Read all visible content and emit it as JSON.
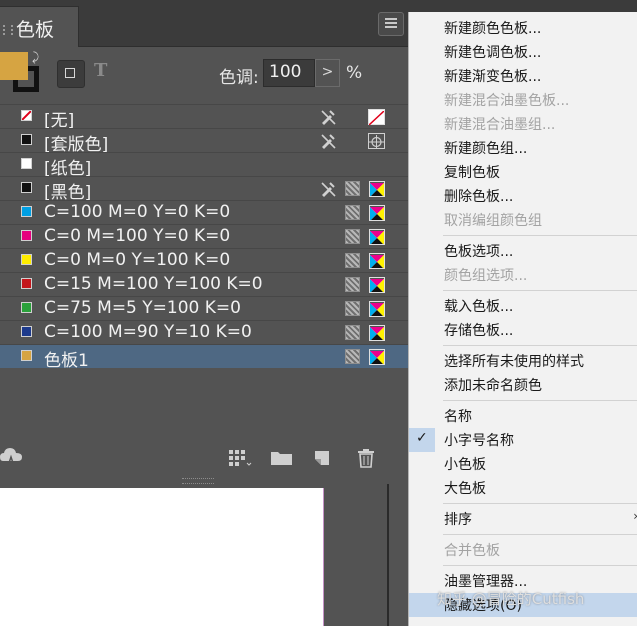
{
  "panel": {
    "tab_label": "色板",
    "tint_label": "色调:",
    "tint_value": "100",
    "tint_stepper": ">",
    "tint_unit": "%",
    "fill_color": "#d6a442",
    "text_mode_glyph": "T"
  },
  "swatches": [
    {
      "name": "[无]",
      "chip": "none",
      "icons": [
        "noedit",
        "none"
      ]
    },
    {
      "name": "[套版色]",
      "chip": "#111111",
      "icons": [
        "noedit",
        "registration"
      ]
    },
    {
      "name": "[纸色]",
      "chip": "#ffffff",
      "icons": []
    },
    {
      "name": "[黑色]",
      "chip": "#111111",
      "icons": [
        "noedit",
        "process",
        "cmyk"
      ]
    },
    {
      "name": "C=100 M=0 Y=0 K=0",
      "chip": "#009fe3",
      "icons": [
        "process",
        "cmyk"
      ]
    },
    {
      "name": "C=0 M=100 Y=0 K=0",
      "chip": "#e6007e",
      "icons": [
        "process",
        "cmyk"
      ]
    },
    {
      "name": "C=0 M=0 Y=100 K=0",
      "chip": "#ffed00",
      "icons": [
        "process",
        "cmyk"
      ]
    },
    {
      "name": "C=15 M=100 Y=100 K=0",
      "chip": "#c4161c",
      "icons": [
        "process",
        "cmyk"
      ]
    },
    {
      "name": "C=75 M=5 Y=100 K=0",
      "chip": "#2aa13b",
      "icons": [
        "process",
        "cmyk"
      ]
    },
    {
      "name": "C=100 M=90 Y=10 K=0",
      "chip": "#1d3a8c",
      "icons": [
        "process",
        "cmyk"
      ]
    },
    {
      "name": "色板1",
      "chip": "#d6a442",
      "icons": [
        "process",
        "cmyk"
      ],
      "selected": true
    }
  ],
  "menu": {
    "items": [
      {
        "label": "新建颜色色板...",
        "disabled": false
      },
      {
        "label": "新建色调色板...",
        "disabled": false
      },
      {
        "label": "新建渐变色板...",
        "disabled": false
      },
      {
        "label": "新建混合油墨色板...",
        "disabled": true
      },
      {
        "label": "新建混合油墨组...",
        "disabled": true
      },
      {
        "label": "新建颜色组...",
        "disabled": false
      },
      {
        "label": "复制色板",
        "disabled": false
      },
      {
        "label": "删除色板...",
        "disabled": false
      },
      {
        "label": "取消编组颜色组",
        "disabled": true
      },
      {
        "label": "色板选项...",
        "disabled": false
      },
      {
        "label": "颜色组选项...",
        "disabled": true
      },
      {
        "label": "载入色板...",
        "disabled": false
      },
      {
        "label": "存储色板...",
        "disabled": false
      },
      {
        "label": "选择所有未使用的样式",
        "disabled": false
      },
      {
        "label": "添加未命名颜色",
        "disabled": false
      },
      {
        "label": "名称",
        "disabled": false
      },
      {
        "label": "小字号名称",
        "disabled": false,
        "checked": true
      },
      {
        "label": "小色板",
        "disabled": false
      },
      {
        "label": "大色板",
        "disabled": false
      },
      {
        "label": "排序",
        "disabled": false,
        "submenu": true
      },
      {
        "label": "合并色板",
        "disabled": true
      },
      {
        "label": "油墨管理器...",
        "disabled": false
      },
      {
        "label": "隐藏选项(O)",
        "disabled": false,
        "highlighted": true
      }
    ],
    "check_glyph": "✓",
    "submenu_glyph": "›"
  },
  "watermark": "知乎 @冒险的Cutfish",
  "colors": {
    "panel_bg": "#535353",
    "selected_row": "#4e6883",
    "menu_bg": "#f2f2f2",
    "menu_highlight": "#c3d6ec"
  }
}
